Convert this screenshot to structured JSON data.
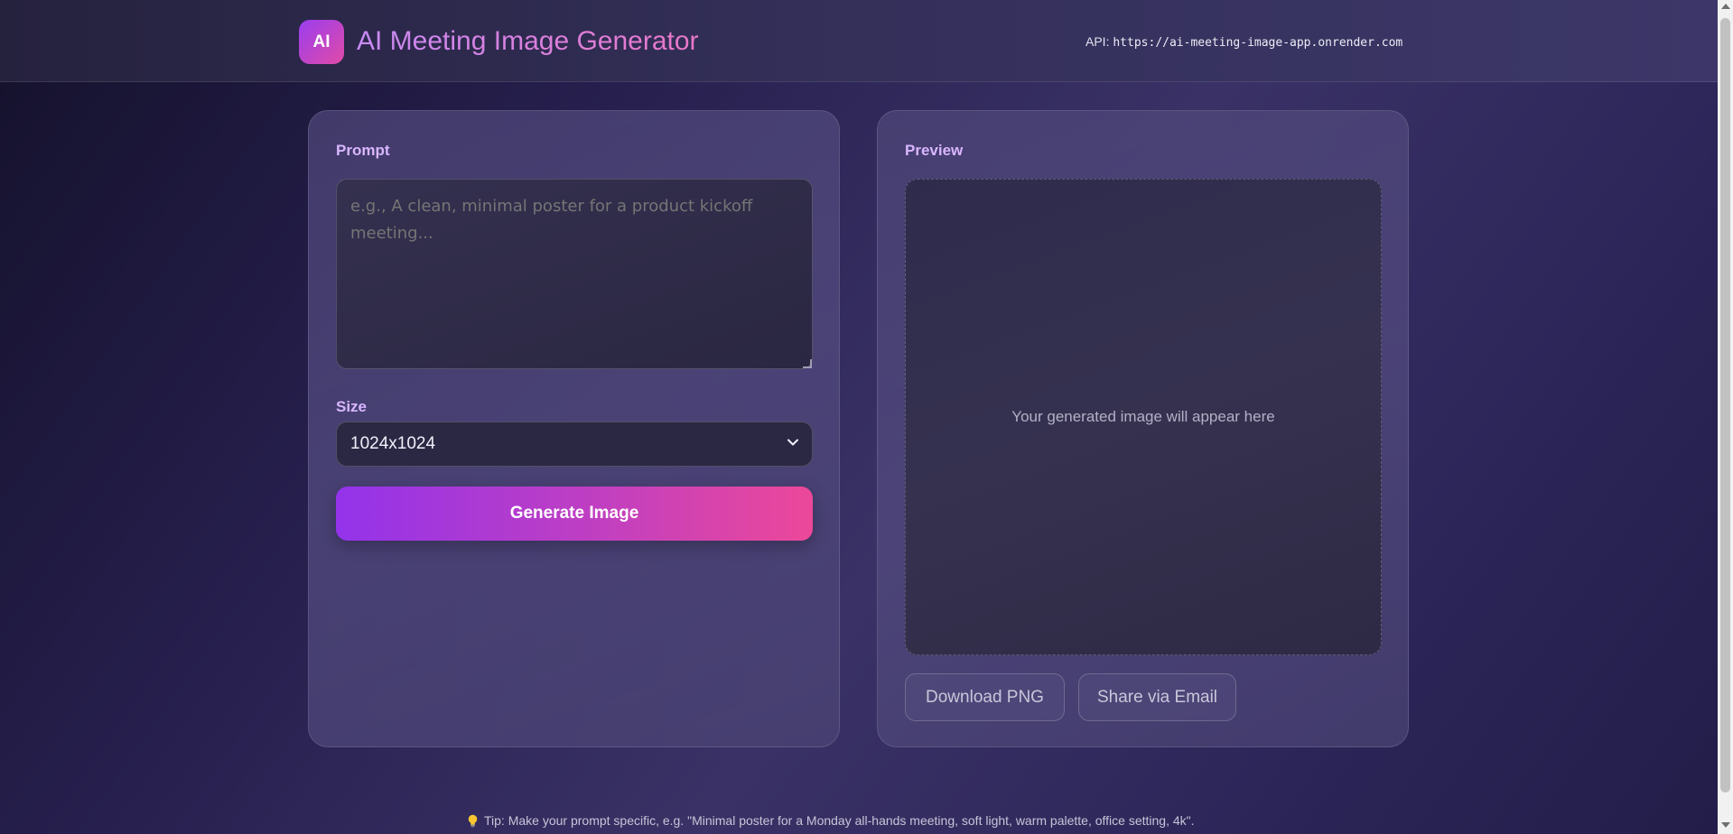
{
  "header": {
    "logo_text": "AI",
    "title": "AI Meeting Image Generator",
    "api_label": "API:",
    "api_url": "https://ai-meeting-image-app.onrender.com"
  },
  "form": {
    "prompt_label": "Prompt",
    "prompt_placeholder": "e.g., A clean, minimal poster for a product kickoff meeting...",
    "prompt_value": "",
    "size_label": "Size",
    "size_selected": "1024x1024",
    "generate_label": "Generate Image"
  },
  "preview": {
    "label": "Preview",
    "placeholder": "Your generated image will appear here",
    "download_label": "Download PNG",
    "share_label": "Share via Email"
  },
  "footer": {
    "tip": "Tip: Make your prompt specific, e.g. \"Minimal poster for a Monday all-hands meeting, soft light, warm palette, office setting, 4k\".",
    "tip_icon": "lightbulb-icon"
  },
  "colors": {
    "accent_start": "#9333ea",
    "accent_end": "#ec4899",
    "label_color": "#d9b6ff"
  }
}
